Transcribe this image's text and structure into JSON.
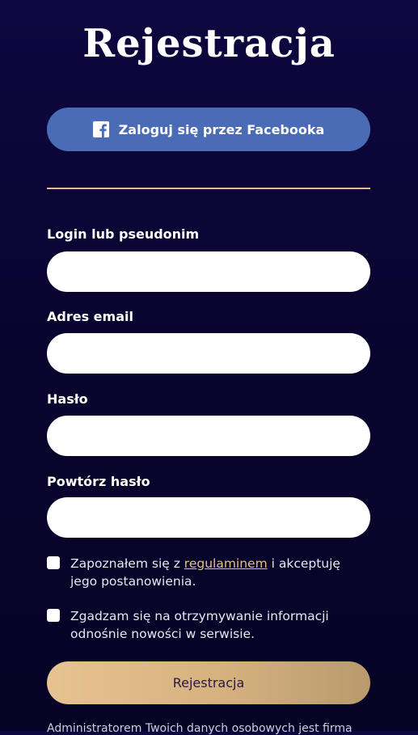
{
  "page": {
    "title": "Rejestracja"
  },
  "facebook": {
    "label": "Zaloguj się przez Facebooka",
    "icon": "facebook-icon",
    "color": "#4a6bb5"
  },
  "form": {
    "login_label": "Login lub pseudonim",
    "login_value": "",
    "email_label": "Adres email",
    "email_value": "",
    "password_label": "Hasło",
    "password_value": "",
    "repeat_password_label": "Powtórz hasło",
    "repeat_password_value": ""
  },
  "consents": {
    "terms_prefix": "Zapoznałem się z ",
    "terms_link": "regulaminem",
    "terms_suffix": " i akceptuję jego postanowienia.",
    "terms_checked": false,
    "newsletter": "Zgadzam się na otrzymywanie informacji odnośnie nowości w serwisie.",
    "newsletter_checked": false
  },
  "submit": {
    "label": "Rejestracja"
  },
  "footer": {
    "note": "Administratorem Twoich danych osobowych jest firma"
  },
  "colors": {
    "background": "#0a0533",
    "accent_gold": "#e0bd8a",
    "link": "#e8c080"
  }
}
